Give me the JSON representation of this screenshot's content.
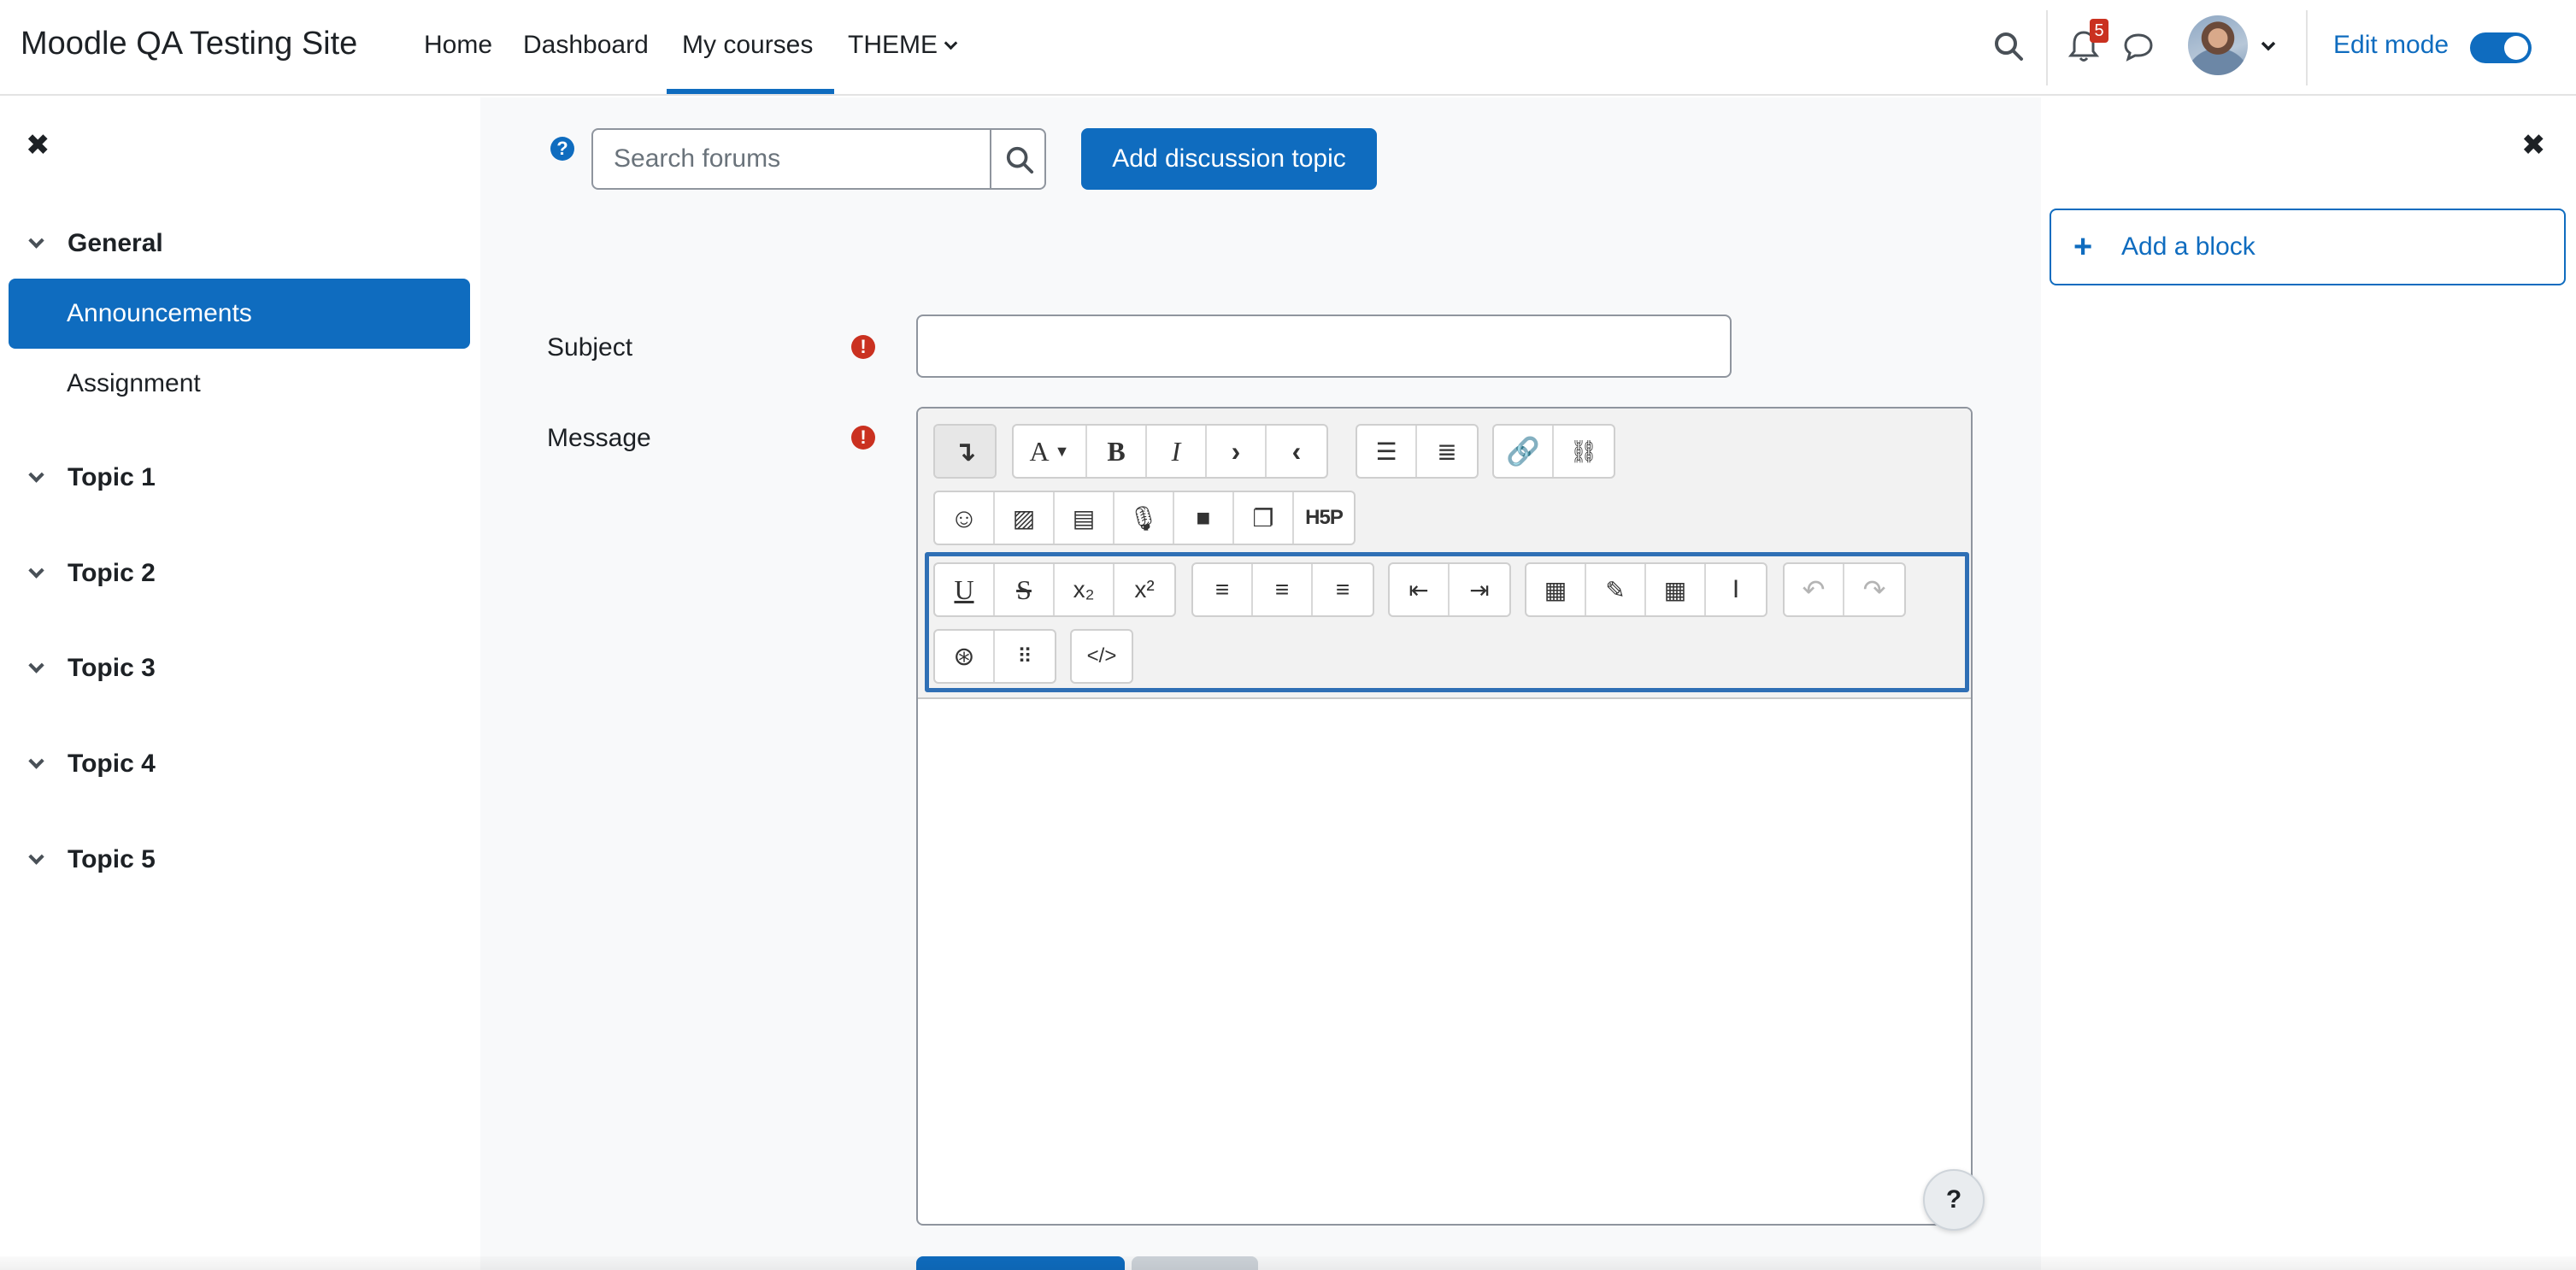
{
  "navbar": {
    "site_name": "Moodle QA Testing Site",
    "links": {
      "home": "Home",
      "dashboard": "Dashboard",
      "my_courses": "My courses",
      "theme": "THEME"
    },
    "notification_count": "5",
    "edit_mode_label": "Edit mode",
    "edit_mode_on": true
  },
  "course_index": {
    "sections": {
      "general": "General",
      "topic1": "Topic 1",
      "topic2": "Topic 2",
      "topic3": "Topic 3",
      "topic4": "Topic 4",
      "topic5": "Topic 5"
    },
    "activities": {
      "announcements": "Announcements",
      "assignment": "Assignment"
    }
  },
  "forum": {
    "search_placeholder": "Search forums",
    "add_topic_label": "Add discussion topic",
    "subject_label": "Subject",
    "subject_value": "",
    "message_label": "Message",
    "required_icon": "!",
    "help_icon": "?"
  },
  "editor": {
    "toolbar_row1": [
      "collapse-icon",
      "font-style-icon",
      "bold-icon",
      "italic-icon",
      "ltr-icon",
      "rtl-icon",
      "unordered-list-icon",
      "ordered-list-icon",
      "link-icon",
      "unlink-icon"
    ],
    "toolbar_row2": [
      "emoji-icon",
      "image-icon",
      "media-icon",
      "microphone-icon",
      "video-icon",
      "copy-icon",
      "h5p-icon"
    ],
    "toolbar_row3": [
      "underline-icon",
      "strikethrough-icon",
      "subscript-icon",
      "superscript-icon",
      "align-left-icon",
      "align-center-icon",
      "align-right-icon",
      "outdent-icon",
      "indent-icon",
      "equation-icon",
      "special-char-icon",
      "table-icon",
      "clear-format-icon",
      "undo-icon",
      "redo-icon"
    ],
    "toolbar_row4": [
      "accessibility-checker-icon",
      "screenreader-helper-icon",
      "html-icon"
    ],
    "h5p_label": "H5P",
    "help_label": "?"
  },
  "blocks": {
    "add_block_label": "Add a block"
  },
  "colors": {
    "primary": "#0f6cbf",
    "danger": "#ca3120",
    "focus": "#2f6fb5"
  }
}
